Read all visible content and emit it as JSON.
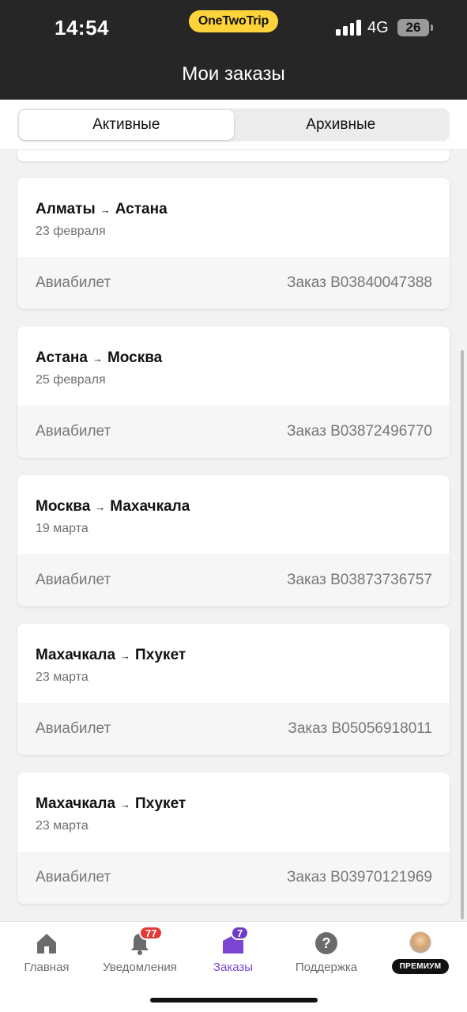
{
  "status_bar": {
    "time": "14:54",
    "network": "4G",
    "battery": "26"
  },
  "brand": {
    "name": "OneTwoTrip"
  },
  "header": {
    "title": "Мои заказы"
  },
  "tabs": [
    {
      "label": "Активные",
      "active": true
    },
    {
      "label": "Архивные",
      "active": false
    }
  ],
  "orders": [
    {
      "from": "Алматы",
      "to": "Астана",
      "date": "23 февраля",
      "type": "Авиабилет",
      "order": "Заказ B03840047388"
    },
    {
      "from": "Астана",
      "to": "Москва",
      "date": "25 февраля",
      "type": "Авиабилет",
      "order": "Заказ B03872496770"
    },
    {
      "from": "Москва",
      "to": "Махачкала",
      "date": "19 марта",
      "type": "Авиабилет",
      "order": "Заказ B03873736757"
    },
    {
      "from": "Махачкала",
      "to": "Пхукет",
      "date": "23 марта",
      "type": "Авиабилет",
      "order": "Заказ B05056918011"
    },
    {
      "from": "Махачкала",
      "to": "Пхукет",
      "date": "23 марта",
      "type": "Авиабилет",
      "order": "Заказ B03970121969"
    }
  ],
  "nav": {
    "home": "Главная",
    "notifications": "Уведомления",
    "notifications_badge": "77",
    "orders": "Заказы",
    "orders_badge": "7",
    "support": "Поддержка",
    "premium": "ПРЕМИУМ"
  },
  "colors": {
    "accent": "#7b45d4",
    "brand_yellow": "#ffd43b",
    "badge_red": "#e53935",
    "header_bg": "#262626"
  },
  "icons": {
    "home": "home-icon",
    "notifications": "bell-icon",
    "orders": "bag-icon",
    "support": "question-icon",
    "profile": "avatar"
  }
}
